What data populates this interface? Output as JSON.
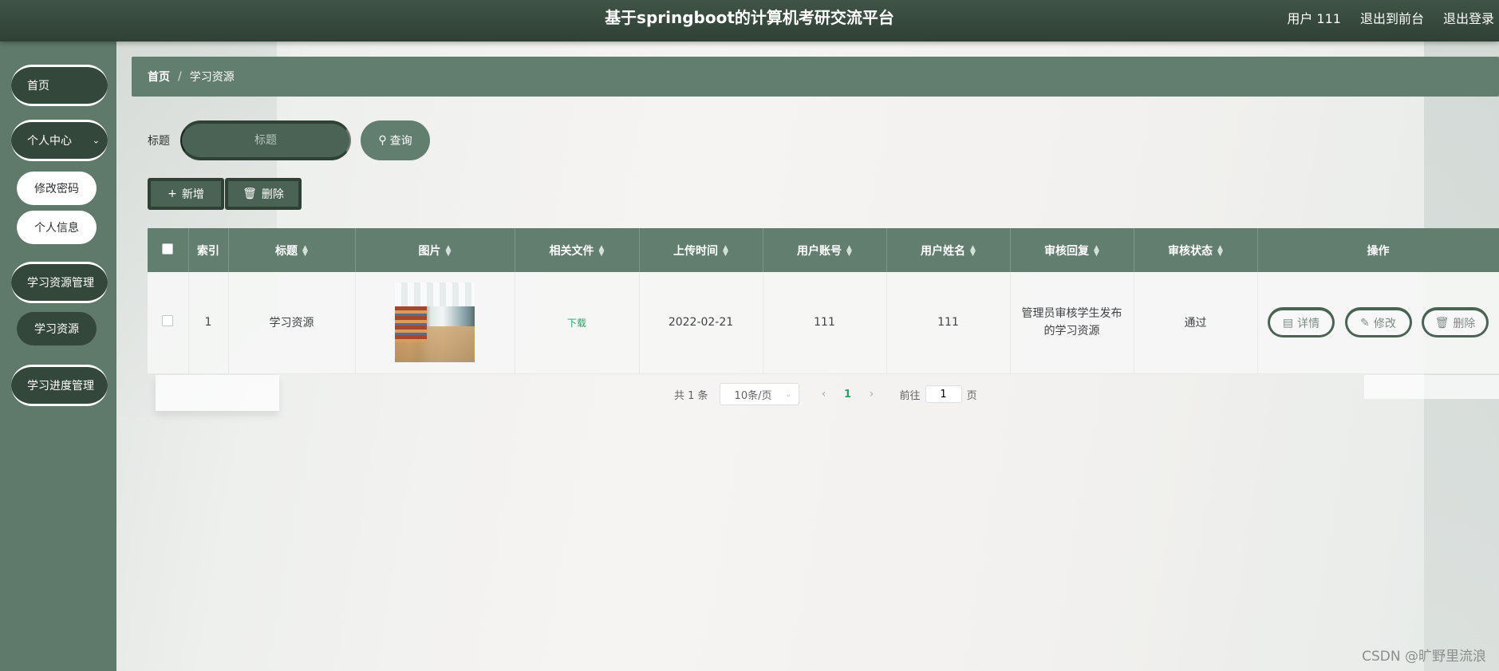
{
  "header": {
    "title": "基于springboot的计算机考研交流平台",
    "user": "用户 111",
    "exit_front": "退出到前台",
    "logout": "退出登录"
  },
  "sidebar": {
    "home": "首页",
    "personal_center": "个人中心",
    "change_password": "修改密码",
    "personal_info": "个人信息",
    "resource_mgmt": "学习资源管理",
    "resource": "学习资源",
    "progress_mgmt": "学习进度管理"
  },
  "breadcrumb": {
    "home": "首页",
    "separator": "/",
    "current": "学习资源"
  },
  "search": {
    "label": "标题",
    "placeholder": "标题",
    "button": "查询"
  },
  "actions": {
    "add": "新增",
    "delete": "删除"
  },
  "table": {
    "headers": {
      "index": "索引",
      "title": "标题",
      "image": "图片",
      "file": "相关文件",
      "upload_time": "上传时间",
      "account": "用户账号",
      "name": "用户姓名",
      "reply": "审核回复",
      "status": "审核状态",
      "ops": "操作"
    },
    "rows": [
      {
        "index": "1",
        "title": "学习资源",
        "file": "下载",
        "upload_time": "2022-02-21",
        "account": "111",
        "name": "111",
        "reply": "管理员审核学生发布的学习资源",
        "status": "通过"
      }
    ],
    "ops": {
      "detail": "详情",
      "edit": "修改",
      "delete": "删除"
    }
  },
  "pagination": {
    "total": "共 1 条",
    "page_size": "10条/页",
    "current": "1",
    "goto_label": "前往",
    "goto_value": "1",
    "page_unit": "页"
  },
  "watermark": "CSDN @旷野里流浪",
  "colors": {
    "header": "#2f4034",
    "accent": "#627e6f",
    "dark_green": "#33473a",
    "link_green": "#29a36a"
  }
}
